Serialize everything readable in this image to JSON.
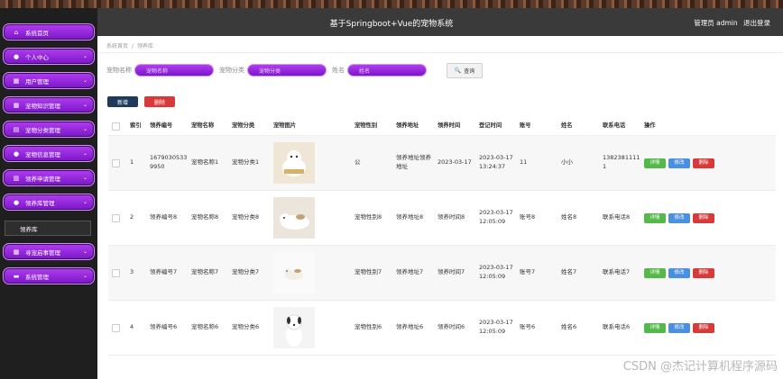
{
  "header": {
    "title": "基于Springboot+Vue的宠物系统",
    "user": "管理员 admin",
    "logout": "退出登录"
  },
  "sidebar": {
    "items": [
      {
        "label": "系统首页",
        "icon": "home-icon",
        "glyph": "⌂",
        "has_chevron": false
      },
      {
        "label": "个人中心",
        "icon": "user-icon",
        "glyph": "●",
        "has_chevron": true
      },
      {
        "label": "用户管理",
        "icon": "grid-icon",
        "glyph": "▦",
        "has_chevron": true
      },
      {
        "label": "宠物知识管理",
        "icon": "grid-icon",
        "glyph": "▦",
        "has_chevron": true
      },
      {
        "label": "宠物分类管理",
        "icon": "doc-icon",
        "glyph": "▤",
        "has_chevron": true
      },
      {
        "label": "宠物信息管理",
        "icon": "user-icon",
        "glyph": "●",
        "has_chevron": true
      },
      {
        "label": "领养申请管理",
        "icon": "chart-icon",
        "glyph": "▥",
        "has_chevron": true
      },
      {
        "label": "领养库管理",
        "icon": "user-icon",
        "glyph": "●",
        "has_chevron": true
      },
      {
        "label": "寻宠启事管理",
        "icon": "grid-icon",
        "glyph": "▦",
        "has_chevron": true
      },
      {
        "label": "系统管理",
        "icon": "briefcase-icon",
        "glyph": "▬",
        "has_chevron": true
      }
    ],
    "sub_item": "领养库"
  },
  "breadcrumb": {
    "home": "系统首页",
    "current": "领养库"
  },
  "search": {
    "fields": [
      {
        "label": "宠物名称",
        "placeholder": "宠物名称"
      },
      {
        "label": "宠物分类",
        "placeholder": "宠物分类"
      },
      {
        "label": "姓名",
        "placeholder": "姓名"
      }
    ],
    "button": "查询"
  },
  "actions": {
    "add": "新增",
    "delete": "删除"
  },
  "table": {
    "headers": [
      "索引",
      "领养编号",
      "宠物名称",
      "宠物分类",
      "宠物图片",
      "宠物性别",
      "领养地址",
      "领养时间",
      "登记时间",
      "账号",
      "姓名",
      "联系电话",
      "操作"
    ],
    "rows": [
      {
        "idx": "1",
        "code": "16790305339950",
        "name": "宠物名称1",
        "category": "宠物分类1",
        "image": "dog-photo-1",
        "sex": "公",
        "address": "领养地址领养地址",
        "adopt_time": "2023-03-17",
        "reg_time": "2023-03-17 13:24:37",
        "account": "11",
        "person": "小小",
        "phone": "13823811111"
      },
      {
        "idx": "2",
        "code": "领养编号8",
        "name": "宠物名称8",
        "category": "宠物分类8",
        "image": "dog-photo-2",
        "sex": "宠物性别8",
        "address": "领养地址8",
        "adopt_time": "领养时间8",
        "reg_time": "2023-03-17 12:05:09",
        "account": "账号8",
        "person": "姓名8",
        "phone": "联系电话8"
      },
      {
        "idx": "3",
        "code": "领养编号7",
        "name": "宠物名称7",
        "category": "宠物分类7",
        "image": "dog-photo-3",
        "sex": "宠物性别7",
        "address": "领养地址7",
        "adopt_time": "领养时间7",
        "reg_time": "2023-03-17 12:05:09",
        "account": "账号7",
        "person": "姓名7",
        "phone": "联系电话7"
      },
      {
        "idx": "4",
        "code": "领养编号6",
        "name": "宠物名称6",
        "category": "宠物分类6",
        "image": "dog-photo-4",
        "sex": "宠物性别6",
        "address": "领养地址6",
        "adopt_time": "领养时间6",
        "reg_time": "2023-03-17 12:05:09",
        "account": "账号6",
        "person": "姓名6",
        "phone": "联系电话6"
      }
    ],
    "ops": {
      "detail": "详情",
      "edit": "修改",
      "delete": "删除"
    }
  },
  "watermark": "CSDN @杰记计算机程序源码"
}
